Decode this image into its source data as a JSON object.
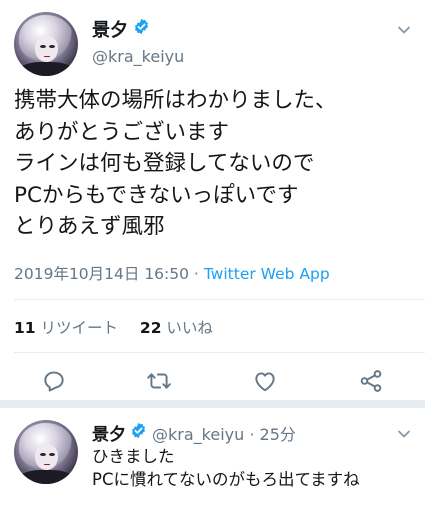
{
  "tweet": {
    "display_name": "景夕",
    "handle": "@kra_keiyu",
    "body_lines": [
      "携帯大体の場所はわかりました、",
      "ありがとうございます",
      "ラインは何も登録してないので",
      "PCからもできないっぽいです",
      "とりあえず風邪"
    ],
    "timestamp": "2019年10月14日 16:50",
    "separator": " · ",
    "source": "Twitter Web App",
    "retweet_count": "11",
    "retweet_label": "リツイート",
    "like_count": "22",
    "like_label": "いいね"
  },
  "reply": {
    "display_name": "景夕",
    "handle": "@kra_keiyu",
    "separator": " · ",
    "time_ago": "25分",
    "body_lines": [
      "ひきました",
      "PCに慣れてないのがもろ出てますね"
    ]
  },
  "colors": {
    "text": "#14171a",
    "muted": "#657786",
    "link": "#1da1f2",
    "divider": "#e6ecf0"
  },
  "icons": [
    "verified-icon",
    "chevron-down-icon",
    "reply-icon",
    "retweet-icon",
    "like-icon",
    "share-icon"
  ]
}
